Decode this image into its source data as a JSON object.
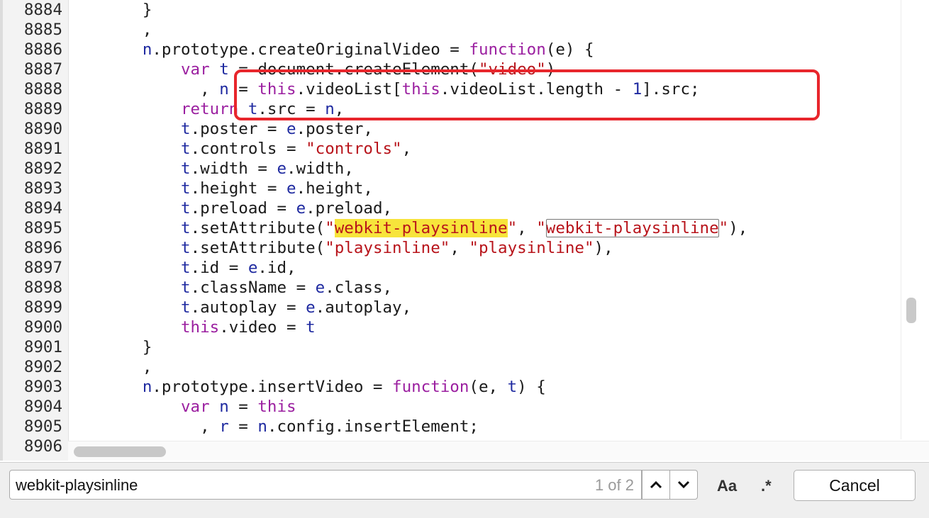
{
  "editor": {
    "lines": [
      {
        "num": "8884",
        "indent": "       ",
        "tokens": [
          {
            "t": "}",
            "c": ""
          }
        ]
      },
      {
        "num": "8885",
        "indent": "       ",
        "tokens": [
          {
            "t": ",",
            "c": ""
          }
        ]
      },
      {
        "num": "8886",
        "indent": "       ",
        "tokens": [
          {
            "t": "n",
            "c": "v"
          },
          {
            "t": ".prototype.createOriginalVideo = ",
            "c": ""
          },
          {
            "t": "function",
            "c": "k"
          },
          {
            "t": "(e) {",
            "c": ""
          }
        ]
      },
      {
        "num": "8887",
        "indent": "           ",
        "tokens": [
          {
            "t": "var",
            "c": "k"
          },
          {
            "t": " ",
            "c": ""
          },
          {
            "t": "t",
            "c": "v"
          },
          {
            "t": " = document.createElement(",
            "c": ""
          },
          {
            "t": "\"video\"",
            "c": "s"
          },
          {
            "t": ")",
            "c": ""
          }
        ]
      },
      {
        "num": "8888",
        "indent": "             ",
        "tokens": [
          {
            "t": ", ",
            "c": ""
          },
          {
            "t": "n",
            "c": "v"
          },
          {
            "t": " = ",
            "c": ""
          },
          {
            "t": "this",
            "c": "k"
          },
          {
            "t": ".videoList[",
            "c": ""
          },
          {
            "t": "this",
            "c": "k"
          },
          {
            "t": ".videoList.length - ",
            "c": ""
          },
          {
            "t": "1",
            "c": "n"
          },
          {
            "t": "].src;",
            "c": ""
          }
        ]
      },
      {
        "num": "8889",
        "indent": "           ",
        "tokens": [
          {
            "t": "return",
            "c": "k"
          },
          {
            "t": " ",
            "c": ""
          },
          {
            "t": "t",
            "c": "v"
          },
          {
            "t": ".src = ",
            "c": ""
          },
          {
            "t": "n",
            "c": "v"
          },
          {
            "t": ",",
            "c": ""
          }
        ]
      },
      {
        "num": "8890",
        "indent": "           ",
        "tokens": [
          {
            "t": "t",
            "c": "v"
          },
          {
            "t": ".poster = ",
            "c": ""
          },
          {
            "t": "e",
            "c": "v"
          },
          {
            "t": ".poster,",
            "c": ""
          }
        ]
      },
      {
        "num": "8891",
        "indent": "           ",
        "tokens": [
          {
            "t": "t",
            "c": "v"
          },
          {
            "t": ".controls = ",
            "c": ""
          },
          {
            "t": "\"controls\"",
            "c": "s"
          },
          {
            "t": ",",
            "c": ""
          }
        ]
      },
      {
        "num": "8892",
        "indent": "           ",
        "tokens": [
          {
            "t": "t",
            "c": "v"
          },
          {
            "t": ".width = ",
            "c": ""
          },
          {
            "t": "e",
            "c": "v"
          },
          {
            "t": ".width,",
            "c": ""
          }
        ]
      },
      {
        "num": "8893",
        "indent": "           ",
        "tokens": [
          {
            "t": "t",
            "c": "v"
          },
          {
            "t": ".height = ",
            "c": ""
          },
          {
            "t": "e",
            "c": "v"
          },
          {
            "t": ".height,",
            "c": ""
          }
        ]
      },
      {
        "num": "8894",
        "indent": "           ",
        "tokens": [
          {
            "t": "t",
            "c": "v"
          },
          {
            "t": ".preload = ",
            "c": ""
          },
          {
            "t": "e",
            "c": "v"
          },
          {
            "t": ".preload,",
            "c": ""
          }
        ]
      },
      {
        "num": "8895",
        "indent": "           ",
        "tokens": [
          {
            "t": "t",
            "c": "v"
          },
          {
            "t": ".setAttribute(",
            "c": ""
          },
          {
            "t": "\"",
            "c": "s"
          },
          {
            "t": "webkit-playsinline",
            "c": "s hl"
          },
          {
            "t": "\"",
            "c": "s"
          },
          {
            "t": ", ",
            "c": ""
          },
          {
            "t": "\"",
            "c": "s"
          },
          {
            "t": "webkit-playsinline",
            "c": "s hl2"
          },
          {
            "t": "\"",
            "c": "s"
          },
          {
            "t": "),",
            "c": ""
          }
        ]
      },
      {
        "num": "8896",
        "indent": "           ",
        "tokens": [
          {
            "t": "t",
            "c": "v"
          },
          {
            "t": ".setAttribute(",
            "c": ""
          },
          {
            "t": "\"playsinline\"",
            "c": "s"
          },
          {
            "t": ", ",
            "c": ""
          },
          {
            "t": "\"playsinline\"",
            "c": "s"
          },
          {
            "t": "),",
            "c": ""
          }
        ]
      },
      {
        "num": "8897",
        "indent": "           ",
        "tokens": [
          {
            "t": "t",
            "c": "v"
          },
          {
            "t": ".id = ",
            "c": ""
          },
          {
            "t": "e",
            "c": "v"
          },
          {
            "t": ".id,",
            "c": ""
          }
        ]
      },
      {
        "num": "8898",
        "indent": "           ",
        "tokens": [
          {
            "t": "t",
            "c": "v"
          },
          {
            "t": ".className = ",
            "c": ""
          },
          {
            "t": "e",
            "c": "v"
          },
          {
            "t": ".class,",
            "c": ""
          }
        ]
      },
      {
        "num": "8899",
        "indent": "           ",
        "tokens": [
          {
            "t": "t",
            "c": "v"
          },
          {
            "t": ".autoplay = ",
            "c": ""
          },
          {
            "t": "e",
            "c": "v"
          },
          {
            "t": ".autoplay,",
            "c": ""
          }
        ]
      },
      {
        "num": "8900",
        "indent": "           ",
        "tokens": [
          {
            "t": "this",
            "c": "k"
          },
          {
            "t": ".video = ",
            "c": ""
          },
          {
            "t": "t",
            "c": "v"
          }
        ]
      },
      {
        "num": "8901",
        "indent": "       ",
        "tokens": [
          {
            "t": "}",
            "c": ""
          }
        ]
      },
      {
        "num": "8902",
        "indent": "       ",
        "tokens": [
          {
            "t": ",",
            "c": ""
          }
        ]
      },
      {
        "num": "8903",
        "indent": "       ",
        "tokens": [
          {
            "t": "n",
            "c": "v"
          },
          {
            "t": ".prototype.insertVideo = ",
            "c": ""
          },
          {
            "t": "function",
            "c": "k"
          },
          {
            "t": "(e, ",
            "c": ""
          },
          {
            "t": "t",
            "c": "v"
          },
          {
            "t": ") {",
            "c": ""
          }
        ]
      },
      {
        "num": "8904",
        "indent": "           ",
        "tokens": [
          {
            "t": "var",
            "c": "k"
          },
          {
            "t": " ",
            "c": ""
          },
          {
            "t": "n",
            "c": "v"
          },
          {
            "t": " = ",
            "c": ""
          },
          {
            "t": "this",
            "c": "k"
          }
        ]
      },
      {
        "num": "8905",
        "indent": "             ",
        "tokens": [
          {
            "t": ", ",
            "c": ""
          },
          {
            "t": "r",
            "c": "v"
          },
          {
            "t": " = ",
            "c": ""
          },
          {
            "t": "n",
            "c": "v"
          },
          {
            "t": ".config.insertElement;",
            "c": ""
          }
        ]
      },
      {
        "num": "8906",
        "indent": "",
        "tokens": [
          {
            "t": "",
            "c": ""
          }
        ]
      }
    ]
  },
  "find_bar": {
    "query": "webkit-playsinline",
    "match_count": "1 of 2",
    "match_case_label": "Aa",
    "regex_label": ".*",
    "cancel_label": "Cancel"
  }
}
